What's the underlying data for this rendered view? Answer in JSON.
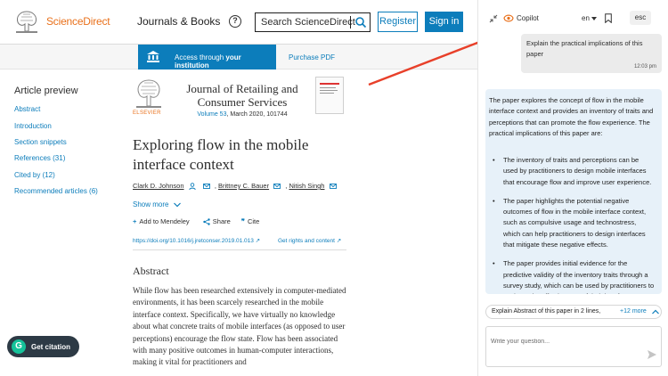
{
  "header": {
    "brand": "ScienceDirect",
    "journals_link": "Journals & Books",
    "help_icon": "?",
    "search_placeholder": "Search ScienceDirect",
    "register_label": "Register",
    "signin_label": "Sign in"
  },
  "access_bar": {
    "access_prefix": "Access through ",
    "access_bold": "your institution",
    "purchase_label": "Purchase PDF"
  },
  "outline": {
    "title": "Article preview",
    "items": [
      "Abstract",
      "Introduction",
      "Section snippets",
      "References (31)",
      "Cited by (12)",
      "Recommended articles (6)"
    ]
  },
  "article": {
    "publisher_logo_text": "ELSEVIER",
    "journal_title": "Journal of Retailing and Consumer Services",
    "volume_link": "Volume 53",
    "volume_rest": ", March 2020, 101744",
    "title": "Exploring flow in the mobile interface context",
    "authors": [
      "Clark D. Johnson",
      "Brittney C. Bauer",
      "Nitish Singh"
    ],
    "show_more": "Show more",
    "actions": {
      "mendeley": "Add to Mendeley",
      "share": "Share",
      "cite": "Cite"
    },
    "doi": "https://doi.org/10.1016/j.jretconser.2019.01.013 ↗",
    "rights": "Get rights and content ↗",
    "abstract_heading": "Abstract",
    "abstract_text": "While flow has been researched extensively in computer-mediated environments, it has been scarcely researched in the mobile interface context. Specifically, we have virtually no knowledge about what concrete traits of mobile interfaces (as opposed to user perceptions) encourage the flow state. Flow has been associated with many positive outcomes in human-computer interactions, making it vital for practitioners and"
  },
  "citation_button": "Get citation",
  "copilot": {
    "title": "Copilot",
    "language": "en",
    "esc_label": "esc",
    "user_message": "Explain the practical implications of this paper",
    "user_time": "12:03 pm",
    "bot_intro": "The paper explores the concept of flow in the mobile interface context and provides an inventory of traits and perceptions that can promote the flow experience. The practical implications of this paper are:",
    "bot_points": [
      "The inventory of traits and perceptions can be used by practitioners to design mobile interfaces that encourage flow and improve user experience.",
      "The paper highlights the potential negative outcomes of flow in the mobile interface context, such as compulsive usage and technostress, which can help practitioners to design interfaces that mitigate these negative effects.",
      "The paper provides initial evidence for the predictive validity of the inventory traits through a survey study, which can be used by practitioners to evaluate the effectiveness of their interface"
    ],
    "suggestion": "Explain Abstract of this paper in 2 lines,",
    "suggestion_more": "+12 more",
    "input_placeholder": "Write your question..."
  },
  "colors": {
    "brand_orange": "#e9711c",
    "link_blue": "#0c7dbb",
    "annotation_red": "#e8402a",
    "bot_bubble": "#e7f1f9"
  },
  "icons": [
    "tree-logo-icon",
    "help-icon",
    "search-icon",
    "institution-icon",
    "user-icon",
    "mail-icon",
    "chevron-down-icon",
    "mendeley-plus-icon",
    "share-icon",
    "quote-icon",
    "grammarly-icon",
    "collapse-icon",
    "copilot-icon",
    "bookmark-icon",
    "chevron-up-icon",
    "send-icon"
  ]
}
